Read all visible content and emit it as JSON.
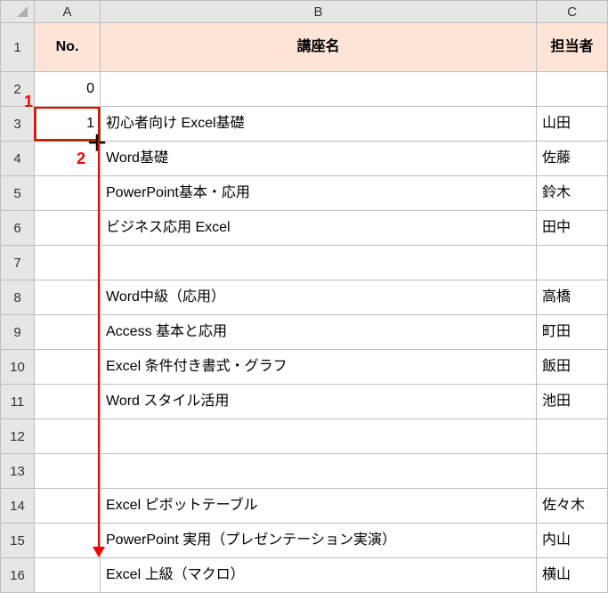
{
  "col_headers": {
    "a": "A",
    "b": "B",
    "c": "C"
  },
  "row_headers": [
    "1",
    "2",
    "3",
    "4",
    "5",
    "6",
    "7",
    "8",
    "9",
    "10",
    "11",
    "12",
    "13",
    "14",
    "15",
    "16"
  ],
  "header_row": {
    "no": "No.",
    "course": "講座名",
    "person": "担当者"
  },
  "rows": [
    {
      "no": "0",
      "course": "",
      "person": ""
    },
    {
      "no": "1",
      "course": "初心者向け Excel基礎",
      "person": "山田"
    },
    {
      "no": "",
      "course": "Word基礎",
      "person": "佐藤"
    },
    {
      "no": "",
      "course": "PowerPoint基本・応用",
      "person": "鈴木"
    },
    {
      "no": "",
      "course": "ビジネス応用 Excel",
      "person": "田中"
    },
    {
      "no": "",
      "course": "",
      "person": ""
    },
    {
      "no": "",
      "course": "Word中級（応用）",
      "person": "高橋"
    },
    {
      "no": "",
      "course": "Access 基本と応用",
      "person": "町田"
    },
    {
      "no": "",
      "course": "Excel 条件付き書式・グラフ",
      "person": "飯田"
    },
    {
      "no": "",
      "course": "Word スタイル活用",
      "person": "池田"
    },
    {
      "no": "",
      "course": "",
      "person": ""
    },
    {
      "no": "",
      "course": "",
      "person": ""
    },
    {
      "no": "",
      "course": "Excel ピボットテーブル",
      "person": "佐々木"
    },
    {
      "no": "",
      "course": "PowerPoint 実用（プレゼンテーション実演）",
      "person": "内山"
    },
    {
      "no": "",
      "course": "Excel 上級（マクロ）",
      "person": "横山"
    }
  ],
  "annotations": {
    "step1": "1",
    "step2": "2",
    "plus": "＋"
  }
}
